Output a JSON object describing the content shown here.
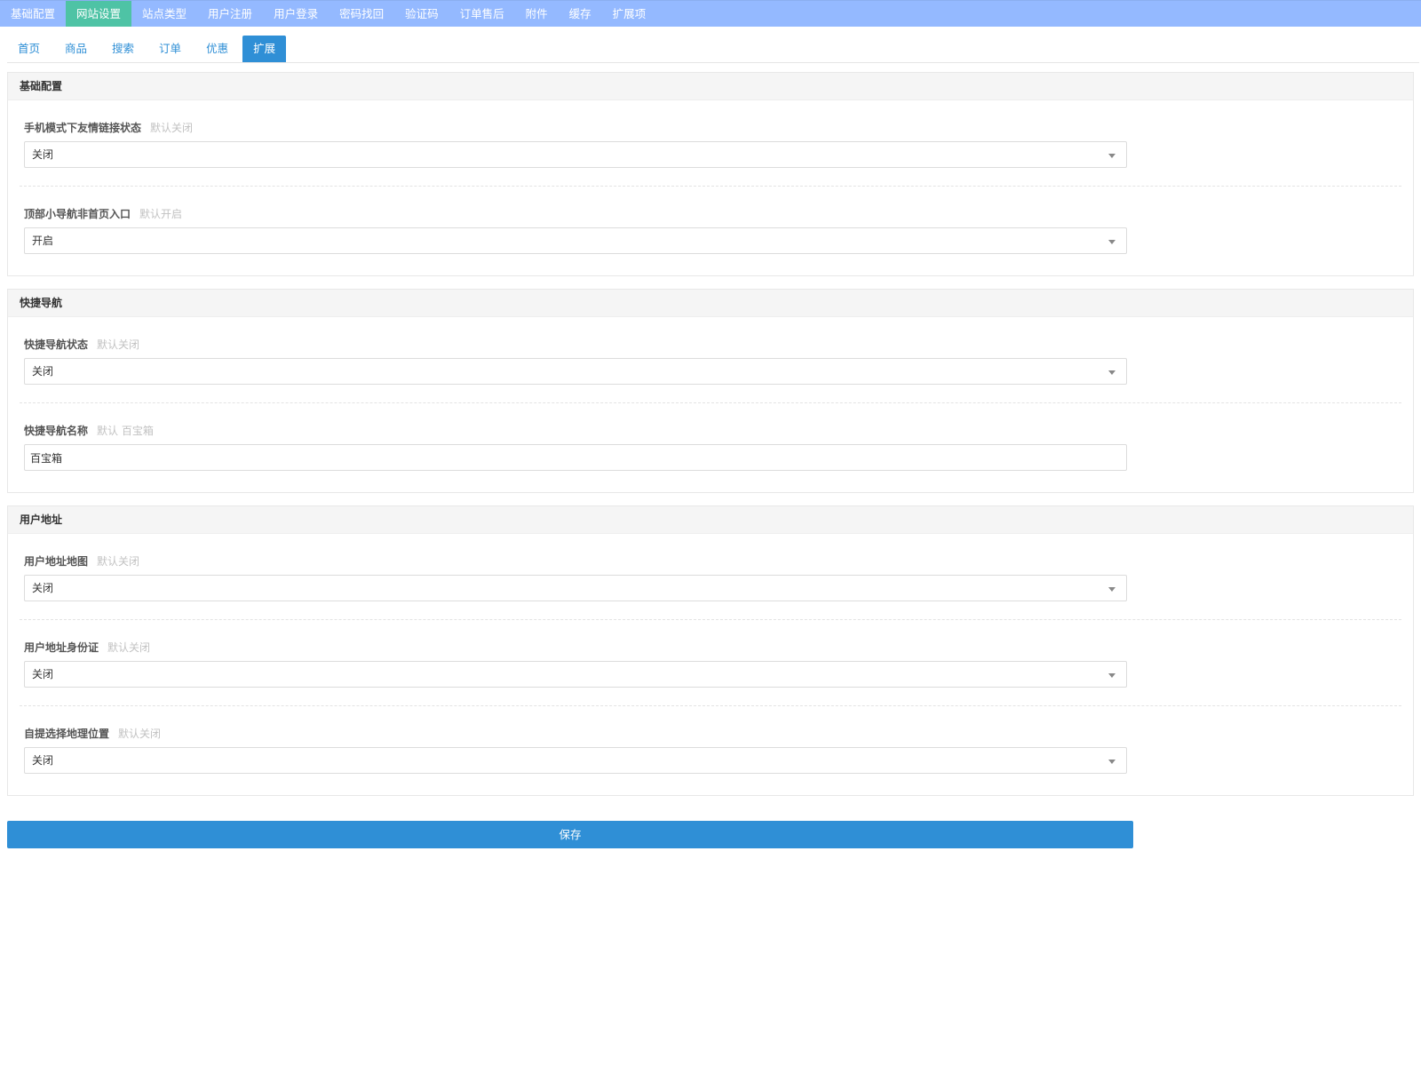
{
  "top_nav": [
    {
      "label": "基础配置",
      "active": false
    },
    {
      "label": "网站设置",
      "active": true
    },
    {
      "label": "站点类型",
      "active": false
    },
    {
      "label": "用户注册",
      "active": false
    },
    {
      "label": "用户登录",
      "active": false
    },
    {
      "label": "密码找回",
      "active": false
    },
    {
      "label": "验证码",
      "active": false
    },
    {
      "label": "订单售后",
      "active": false
    },
    {
      "label": "附件",
      "active": false
    },
    {
      "label": "缓存",
      "active": false
    },
    {
      "label": "扩展项",
      "active": false
    }
  ],
  "sub_tabs": [
    {
      "label": "首页",
      "active": false
    },
    {
      "label": "商品",
      "active": false
    },
    {
      "label": "搜索",
      "active": false
    },
    {
      "label": "订单",
      "active": false
    },
    {
      "label": "优惠",
      "active": false
    },
    {
      "label": "扩展",
      "active": true
    }
  ],
  "sections": [
    {
      "title": "基础配置",
      "fields": [
        {
          "label": "手机模式下友情链接状态",
          "hint": "默认关闭",
          "type": "select",
          "value": "关闭"
        },
        {
          "label": "顶部小导航非首页入口",
          "hint": "默认开启",
          "type": "select",
          "value": "开启"
        }
      ]
    },
    {
      "title": "快捷导航",
      "fields": [
        {
          "label": "快捷导航状态",
          "hint": "默认关闭",
          "type": "select",
          "value": "关闭"
        },
        {
          "label": "快捷导航名称",
          "hint": "默认 百宝箱",
          "type": "input",
          "value": "百宝箱"
        }
      ]
    },
    {
      "title": "用户地址",
      "fields": [
        {
          "label": "用户地址地图",
          "hint": "默认关闭",
          "type": "select",
          "value": "关闭"
        },
        {
          "label": "用户地址身份证",
          "hint": "默认关闭",
          "type": "select",
          "value": "关闭"
        },
        {
          "label": "自提选择地理位置",
          "hint": "默认关闭",
          "type": "select",
          "value": "关闭"
        }
      ]
    }
  ],
  "save_label": "保存"
}
